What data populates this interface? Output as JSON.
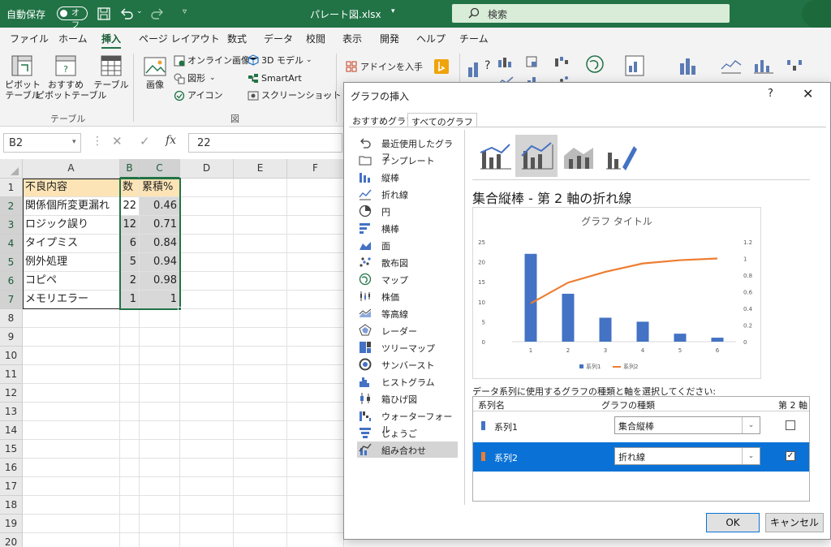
{
  "titlebar": {
    "autosave_label": "自動保存",
    "autosave_state": "オフ",
    "filename": "パレート図.xlsx",
    "search_placeholder": "検索",
    "bg_color": "#217346"
  },
  "menu": {
    "tabs": [
      "ファイル",
      "ホーム",
      "挿入",
      "ページ レイアウト",
      "数式",
      "データ",
      "校閲",
      "表示",
      "開発",
      "ヘルプ",
      "チーム"
    ],
    "active": "挿入"
  },
  "ribbon": {
    "pivot": "ピボット\nテーブル",
    "recommended_pivot": "おすすめ\nピボットテーブル",
    "table": "テーブル",
    "group_table": "テーブル",
    "image": "画像",
    "online_image": "オンライン画像",
    "shapes": "図形",
    "icons": "アイコン",
    "model3d": "3D モデル",
    "smartart": "SmartArt",
    "screenshot": "スクリーンショット",
    "group_fig": "図",
    "addin": "アドインを入手"
  },
  "formula": {
    "namebox": "B2",
    "value": "22"
  },
  "sheet": {
    "columns": [
      "A",
      "B",
      "C",
      "D",
      "E",
      "F"
    ],
    "row_numbers": [
      "1",
      "2",
      "3",
      "4",
      "5",
      "6",
      "7",
      "8",
      "9",
      "10",
      "11",
      "12",
      "13",
      "14",
      "15",
      "16",
      "17",
      "18",
      "19",
      "20"
    ],
    "header": [
      "不良内容",
      "数",
      "累積%"
    ],
    "rows": [
      [
        "関係個所変更漏れ",
        "22",
        "0.46"
      ],
      [
        "ロジック誤り",
        "12",
        "0.71"
      ],
      [
        "タイプミス",
        "6",
        "0.84"
      ],
      [
        "例外処理",
        "5",
        "0.94"
      ],
      [
        "コピペ",
        "2",
        "0.98"
      ],
      [
        "メモリエラー",
        "1",
        "1"
      ]
    ]
  },
  "dialog": {
    "title": "グラフの挿入",
    "help": "?",
    "close": "✕",
    "tabs": [
      "おすすめグラフ",
      "すべてのグラフ"
    ],
    "active_tab": "すべてのグラフ",
    "chart_types": [
      "最近使用したグラフ",
      "テンプレート",
      "縦棒",
      "折れ線",
      "円",
      "横棒",
      "面",
      "散布図",
      "マップ",
      "株価",
      "等高線",
      "レーダー",
      "ツリーマップ",
      "サンバースト",
      "ヒストグラム",
      "箱ひげ図",
      "ウォーターフォール",
      "じょうご",
      "組み合わせ"
    ],
    "active_type": "組み合わせ",
    "subtitle": "集合縦棒 - 第 2 軸の折れ線",
    "series_question": "データ系列に使用するグラフの種類と軸を選択してください:",
    "table_headers": [
      "系列名",
      "グラフの種類",
      "第 2 軸"
    ],
    "series_rows": [
      {
        "name": "系列1",
        "type": "集合縦棒",
        "secondary": "",
        "color": "#4472c4"
      },
      {
        "name": "系列2",
        "type": "折れ線",
        "secondary": "✓",
        "color": "#ed7d31"
      }
    ],
    "ok": "OK",
    "cancel": "キャンセル",
    "select_color": "#0a72d6"
  },
  "chart_data": {
    "type": "bar",
    "title": "グラフ タイトル",
    "categories": [
      "1",
      "2",
      "3",
      "4",
      "5",
      "6"
    ],
    "series": [
      {
        "name": "系列1",
        "kind": "bar",
        "axis": "primary",
        "values": [
          22,
          12,
          6,
          5,
          2,
          1
        ],
        "color": "#4472c4"
      },
      {
        "name": "系列2",
        "kind": "line",
        "axis": "secondary",
        "values": [
          0.46,
          0.71,
          0.84,
          0.94,
          0.98,
          1
        ],
        "color": "#ed7d31"
      }
    ],
    "ylim": [
      0,
      25
    ],
    "y_ticks": [
      "0",
      "5",
      "10",
      "15",
      "20",
      "25"
    ],
    "y2lim": [
      0,
      1.2
    ],
    "y2_ticks": [
      "0",
      "0.2",
      "0.4",
      "0.6",
      "0.8",
      "1",
      "1.2"
    ],
    "grid": false,
    "legend": "bottom"
  }
}
